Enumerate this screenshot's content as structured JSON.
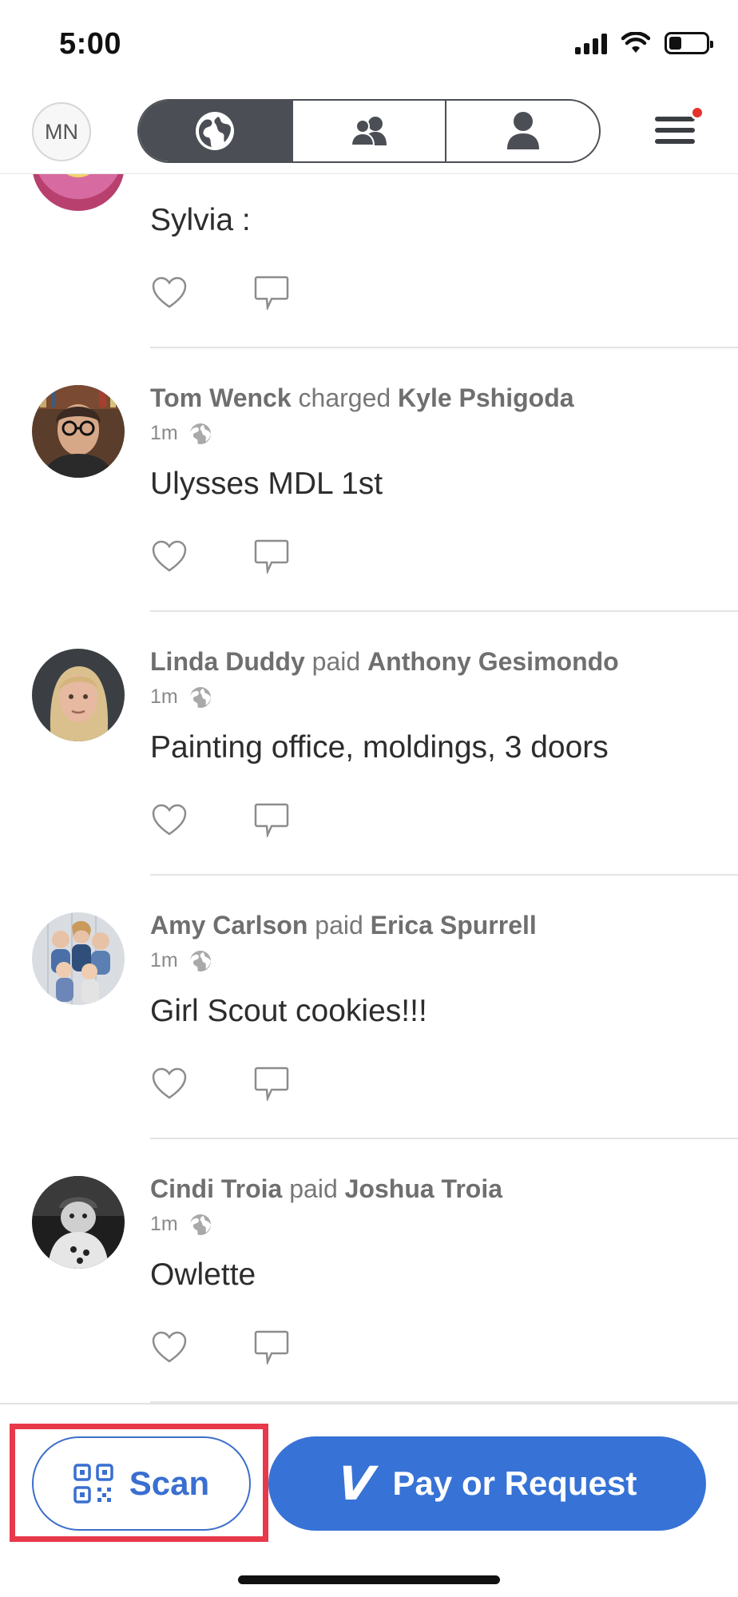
{
  "status_bar": {
    "time": "5:00",
    "battery_level": 0.35
  },
  "header": {
    "profile_initials": "MN",
    "tabs": [
      {
        "icon": "globe-icon",
        "active": true
      },
      {
        "icon": "friends-icon",
        "active": false
      },
      {
        "icon": "person-icon",
        "active": false
      }
    ],
    "menu_has_notification": true
  },
  "feed": {
    "partial_item": {
      "note": "Sylvia :"
    },
    "items": [
      {
        "actor": "Tom Wenck",
        "verb": "charged",
        "target": "Kyle Pshigoda",
        "time": "1m",
        "note": "Ulysses MDL 1st",
        "avatar": "avatar-tom-wenck"
      },
      {
        "actor": "Linda Duddy",
        "verb": "paid",
        "target": "Anthony Gesimondo",
        "time": "1m",
        "note": "Painting office, moldings, 3 doors",
        "avatar": "avatar-linda-duddy"
      },
      {
        "actor": "Amy Carlson",
        "verb": "paid",
        "target": "Erica Spurrell",
        "time": "1m",
        "note": "Girl Scout cookies!!!",
        "avatar": "avatar-amy-carlson"
      },
      {
        "actor": "Cindi Troia",
        "verb": "paid",
        "target": "Joshua Troia",
        "time": "1m",
        "note": "Owlette",
        "avatar": "avatar-cindi-troia"
      }
    ]
  },
  "bottom_bar": {
    "scan_label": "Scan",
    "pay_label": "Pay or Request",
    "pay_logo": "V"
  },
  "colors": {
    "brand_blue": "#3772d6",
    "highlight_red": "#e8394a",
    "segment_dark": "#4b4f55",
    "notification_red": "#e5322d"
  }
}
